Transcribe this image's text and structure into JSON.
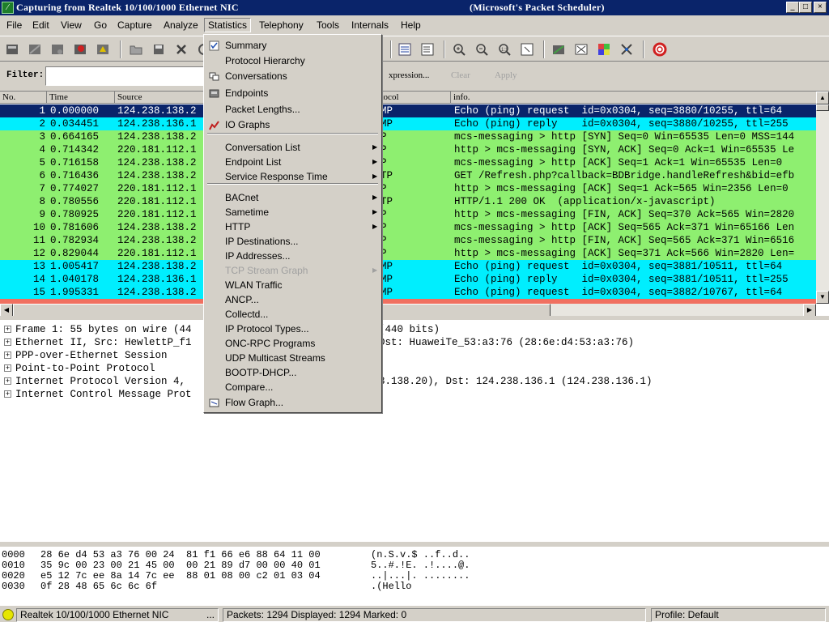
{
  "window": {
    "title": "Capturing from Realtek 10/100/1000 Ethernet NIC",
    "title_right": "(Microsoft's Packet Scheduler)"
  },
  "menubar": [
    "File",
    "Edit",
    "View",
    "Go",
    "Capture",
    "Analyze",
    "Statistics",
    "Telephony",
    "Tools",
    "Internals",
    "Help"
  ],
  "filter": {
    "label": "Filter:",
    "value": "",
    "expression_label": "xpression...",
    "clear_label": "Clear",
    "apply_label": "Apply"
  },
  "packet_list": {
    "columns": [
      "No.",
      "Time",
      "Source",
      "otocol",
      "info."
    ],
    "rows": [
      {
        "no": "1",
        "time": "0.000000",
        "src": "124.238.138.2",
        "proto": "MP",
        "info": "Echo (ping) request  id=0x0304, seq=3880/10255, ttl=64",
        "style": "sel"
      },
      {
        "no": "2",
        "time": "0.034451",
        "src": "124.238.136.1",
        "proto": "MP",
        "info": "Echo (ping) reply    id=0x0304, seq=3880/10255, ttl=255",
        "style": "cyan"
      },
      {
        "no": "3",
        "time": "0.664165",
        "src": "124.238.138.2",
        "proto": "P",
        "info": "mcs-messaging > http [SYN] Seq=0 Win=65535 Len=0 MSS=144",
        "style": "green"
      },
      {
        "no": "4",
        "time": "0.714342",
        "src": "220.181.112.1",
        "proto": "P",
        "info": "http > mcs-messaging [SYN, ACK] Seq=0 Ack=1 Win=65535 Le",
        "style": "green"
      },
      {
        "no": "5",
        "time": "0.716158",
        "src": "124.238.138.2",
        "proto": "P",
        "info": "mcs-messaging > http [ACK] Seq=1 Ack=1 Win=65535 Len=0",
        "style": "green"
      },
      {
        "no": "6",
        "time": "0.716436",
        "src": "124.238.138.2",
        "proto": "TP",
        "info": "GET /Refresh.php?callback=BDBridge.handleRefresh&bid=efb",
        "style": "green"
      },
      {
        "no": "7",
        "time": "0.774027",
        "src": "220.181.112.1",
        "proto": "P",
        "info": "http > mcs-messaging [ACK] Seq=1 Ack=565 Win=2356 Len=0",
        "style": "green"
      },
      {
        "no": "8",
        "time": "0.780556",
        "src": "220.181.112.1",
        "proto": "TP",
        "info": "HTTP/1.1 200 OK  (application/x-javascript)",
        "style": "green"
      },
      {
        "no": "9",
        "time": "0.780925",
        "src": "220.181.112.1",
        "proto": "P",
        "info": "http > mcs-messaging [FIN, ACK] Seq=370 Ack=565 Win=2820",
        "style": "green"
      },
      {
        "no": "10",
        "time": "0.781606",
        "src": "124.238.138.2",
        "proto": "P",
        "info": "mcs-messaging > http [ACK] Seq=565 Ack=371 Win=65166 Len",
        "style": "green"
      },
      {
        "no": "11",
        "time": "0.782934",
        "src": "124.238.138.2",
        "proto": "P",
        "info": "mcs-messaging > http [FIN, ACK] Seq=565 Ack=371 Win=6516",
        "style": "green"
      },
      {
        "no": "12",
        "time": "0.829044",
        "src": "220.181.112.1",
        "proto": "P",
        "info": "http > mcs-messaging [ACK] Seq=371 Ack=566 Win=2820 Len=",
        "style": "green"
      },
      {
        "no": "13",
        "time": "1.005417",
        "src": "124.238.138.2",
        "proto": "MP",
        "info": "Echo (ping) request  id=0x0304, seq=3881/10511, ttl=64",
        "style": "cyan"
      },
      {
        "no": "14",
        "time": "1.040178",
        "src": "124.238.136.1",
        "proto": "MP",
        "info": "Echo (ping) reply    id=0x0304, seq=3881/10511, ttl=255",
        "style": "cyan"
      },
      {
        "no": "15",
        "time": "1.995331",
        "src": "124.238.138.2",
        "proto": "MP",
        "info": "Echo (ping) request  id=0x0304, seq=3882/10767, ttl=64",
        "style": "cyan"
      }
    ]
  },
  "details": [
    {
      "left": "Frame 1: 55 bytes on wire (44",
      "right": "(440 bits)"
    },
    {
      "left": "Ethernet II, Src: HewlettP_f1",
      "right": "Dst: HuaweiTe_53:a3:76 (28:6e:d4:53:a3:76)"
    },
    {
      "left": "PPP-over-Ethernet Session",
      "right": ""
    },
    {
      "left": "Point-to-Point Protocol",
      "right": ""
    },
    {
      "left": "Internet Protocol Version 4,",
      "right": "3.138.20), Dst: 124.238.136.1 (124.238.136.1)"
    },
    {
      "left": "Internet Control Message Prot",
      "right": ""
    }
  ],
  "bytes": [
    {
      "offset": "0000",
      "hex": "28 6e d4 53 a3 76 00 24  81 f1 66 e6 88 64 11 00",
      "ascii": "(n.S.v.$ ..f..d.."
    },
    {
      "offset": "0010",
      "hex": "35 9c 00 23 00 21 45 00  00 21 89 d7 00 00 40 01",
      "ascii": "5..#.!E. .!....@."
    },
    {
      "offset": "0020",
      "hex": "e5 12 7c ee 8a 14 7c ee  88 01 08 00 c2 01 03 04",
      "ascii": "..|...|. ........"
    },
    {
      "offset": "0030",
      "hex": "0f 28 48 65 6c 6c 6f",
      "ascii": ".(Hello"
    }
  ],
  "statusbar": {
    "interface": "Realtek 10/100/1000 Ethernet NIC",
    "ellipsis": "...",
    "packets": "Packets: 1294 Displayed: 1294 Marked: 0",
    "profile": "Profile: Default"
  },
  "statistics_menu": {
    "items": [
      {
        "label": "Summary",
        "icon": "checkbox-icon"
      },
      {
        "label": "Protocol Hierarchy"
      },
      {
        "label": "Conversations",
        "icon": "conversations-icon"
      },
      {
        "label": "Endpoints",
        "icon": "endpoints-icon"
      },
      {
        "label": "Packet Lengths..."
      },
      {
        "label": "IO Graphs",
        "icon": "graph-icon"
      },
      {
        "label": "Conversation List",
        "submenu": true
      },
      {
        "label": "Endpoint List",
        "submenu": true
      },
      {
        "label": "Service Response Time",
        "submenu": true
      },
      {
        "label": "BACnet",
        "submenu": true
      },
      {
        "label": "Sametime",
        "submenu": true
      },
      {
        "label": "HTTP",
        "submenu": true
      },
      {
        "label": "IP Destinations..."
      },
      {
        "label": "IP Addresses..."
      },
      {
        "label": "TCP Stream Graph",
        "submenu": true,
        "disabled": true
      },
      {
        "label": "WLAN Traffic"
      },
      {
        "label": "ANCP..."
      },
      {
        "label": "Collectd..."
      },
      {
        "label": "IP Protocol Types..."
      },
      {
        "label": "ONC-RPC Programs"
      },
      {
        "label": "UDP Multicast Streams"
      },
      {
        "label": "BOOTP-DHCP..."
      },
      {
        "label": "Compare..."
      },
      {
        "label": "Flow Graph...",
        "icon": "flow-graph-icon"
      }
    ]
  },
  "colors": {
    "selected": "#0a246a",
    "icmp": "#00eefe",
    "tcp": "#8eef70"
  }
}
